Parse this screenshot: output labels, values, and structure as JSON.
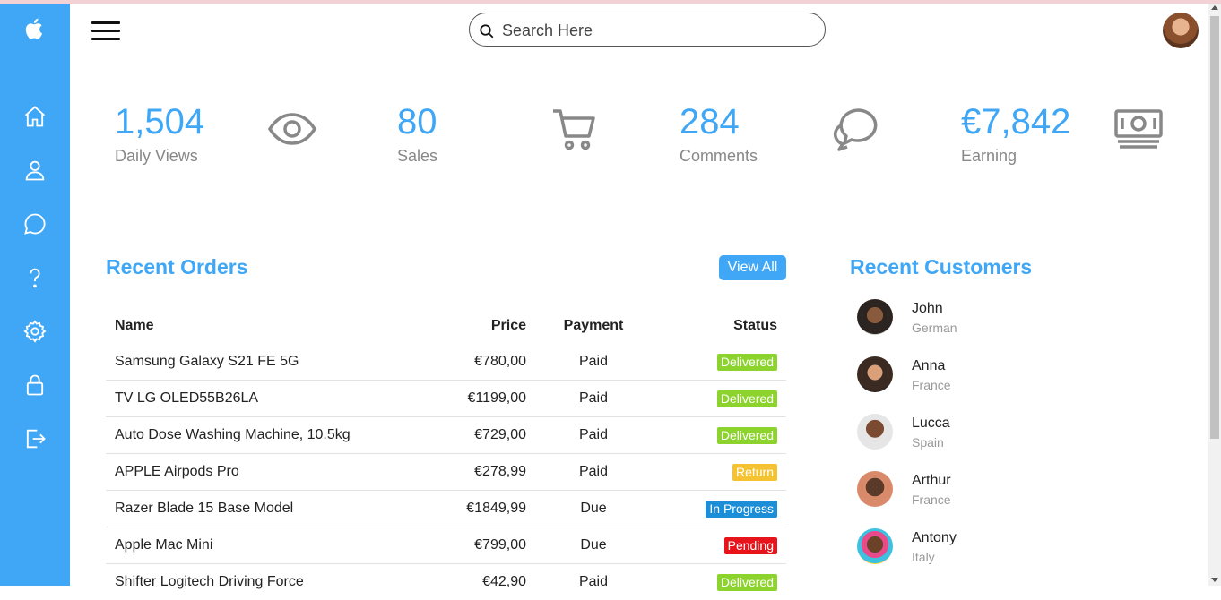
{
  "brand": {
    "logo_icon": "apple-logo-icon",
    "accent_color": "#3fa7f5"
  },
  "sidebar": {
    "items": [
      {
        "icon": "home-icon"
      },
      {
        "icon": "user-icon"
      },
      {
        "icon": "chat-icon"
      },
      {
        "icon": "help-icon"
      },
      {
        "icon": "settings-icon"
      },
      {
        "icon": "lock-icon"
      },
      {
        "icon": "logout-icon"
      }
    ]
  },
  "header": {
    "search_placeholder": "Search Here"
  },
  "cards": [
    {
      "value": "1,504",
      "label": "Daily Views",
      "icon": "eye-icon"
    },
    {
      "value": "80",
      "label": "Sales",
      "icon": "cart-icon"
    },
    {
      "value": "284",
      "label": "Comments",
      "icon": "comments-icon"
    },
    {
      "value": "€7,842",
      "label": "Earning",
      "icon": "cash-icon"
    }
  ],
  "orders": {
    "title": "Recent Orders",
    "view_all": "View All",
    "columns": {
      "name": "Name",
      "price": "Price",
      "payment": "Payment",
      "status": "Status"
    },
    "rows": [
      {
        "name": "Samsung Galaxy S21 FE 5G",
        "price": "€780,00",
        "payment": "Paid",
        "status": "Delivered",
        "status_color": "#8cd42d"
      },
      {
        "name": "TV LG OLED55B26LA",
        "price": "€1199,00",
        "payment": "Paid",
        "status": "Delivered",
        "status_color": "#8cd42d"
      },
      {
        "name": "Auto Dose Washing Machine, 10.5kg",
        "price": "€729,00",
        "payment": "Paid",
        "status": "Delivered",
        "status_color": "#8cd42d"
      },
      {
        "name": "APPLE Airpods Pro",
        "price": "€278,99",
        "payment": "Paid",
        "status": "Return",
        "status_color": "#f5c232"
      },
      {
        "name": "Razer Blade 15 Base Model",
        "price": "€1849,99",
        "payment": "Due",
        "status": "In Progress",
        "status_color": "#1c8ed8"
      },
      {
        "name": "Apple Mac Mini",
        "price": "€799,00",
        "payment": "Due",
        "status": "Pending",
        "status_color": "#e8141b"
      },
      {
        "name": "Shifter Logitech Driving Force",
        "price": "€42,90",
        "payment": "Paid",
        "status": "Delivered",
        "status_color": "#8cd42d"
      }
    ]
  },
  "customers": {
    "title": "Recent Customers",
    "list": [
      {
        "name": "John",
        "country": "German"
      },
      {
        "name": "Anna",
        "country": "France"
      },
      {
        "name": "Lucca",
        "country": "Spain"
      },
      {
        "name": "Arthur",
        "country": "France"
      },
      {
        "name": "Antony",
        "country": "Italy"
      }
    ]
  }
}
